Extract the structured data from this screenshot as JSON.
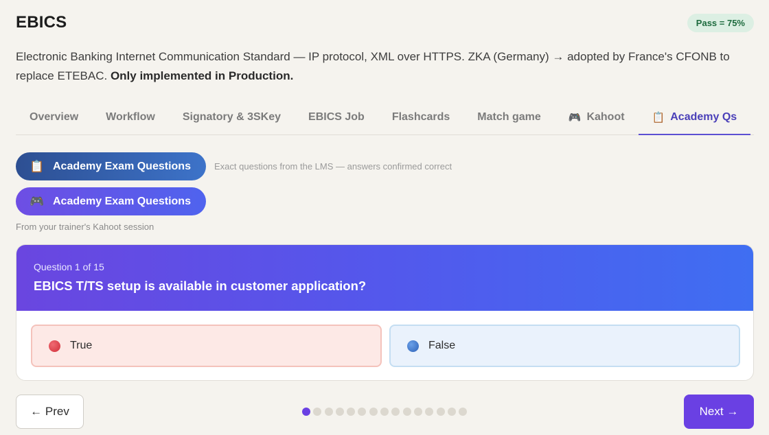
{
  "header": {
    "title": "EBICS",
    "pass_badge": "Pass = 75%"
  },
  "intro": {
    "text": "Electronic Banking Internet Communication Standard — IP protocol, XML over HTTPS. ZKA (Germany) → adopted by France's CFONB to replace ETEBAC. ",
    "bold": "Only implemented in Production."
  },
  "tabs": [
    {
      "label": "Overview",
      "icon": ""
    },
    {
      "label": "Workflow",
      "icon": ""
    },
    {
      "label": "Signatory & 3SKey",
      "icon": ""
    },
    {
      "label": "EBICS Job",
      "icon": ""
    },
    {
      "label": "Flashcards",
      "icon": ""
    },
    {
      "label": "Match game",
      "icon": ""
    },
    {
      "label": "Kahoot",
      "icon": "🎮"
    },
    {
      "label": "Academy Qs",
      "icon": "📋",
      "active": true
    }
  ],
  "sections": [
    {
      "label": "Academy Exam Questions",
      "icon": "📋",
      "icon_name": "clipboard-icon",
      "note": "Exact questions from the LMS — answers confirmed correct"
    },
    {
      "label": "Academy Exam Questions",
      "icon": "🎮",
      "icon_name": "gamepad-icon",
      "note": "From your trainer's Kahoot session"
    }
  ],
  "question": {
    "count": "Question 1 of 15",
    "text": "EBICS T/TS setup is available in customer application?",
    "answers": [
      {
        "label": "True",
        "color": "#d0303a"
      },
      {
        "label": "False",
        "color": "#2e62b8"
      }
    ]
  },
  "pagination": {
    "total": 15,
    "current": 1
  },
  "nav": {
    "prev_label": "← Prev",
    "next_label": "Next →"
  },
  "colors": {
    "accent": "#6a40e3",
    "pass_badge_bg": "#dcefe3",
    "pass_badge_text": "#1d6b3e"
  }
}
